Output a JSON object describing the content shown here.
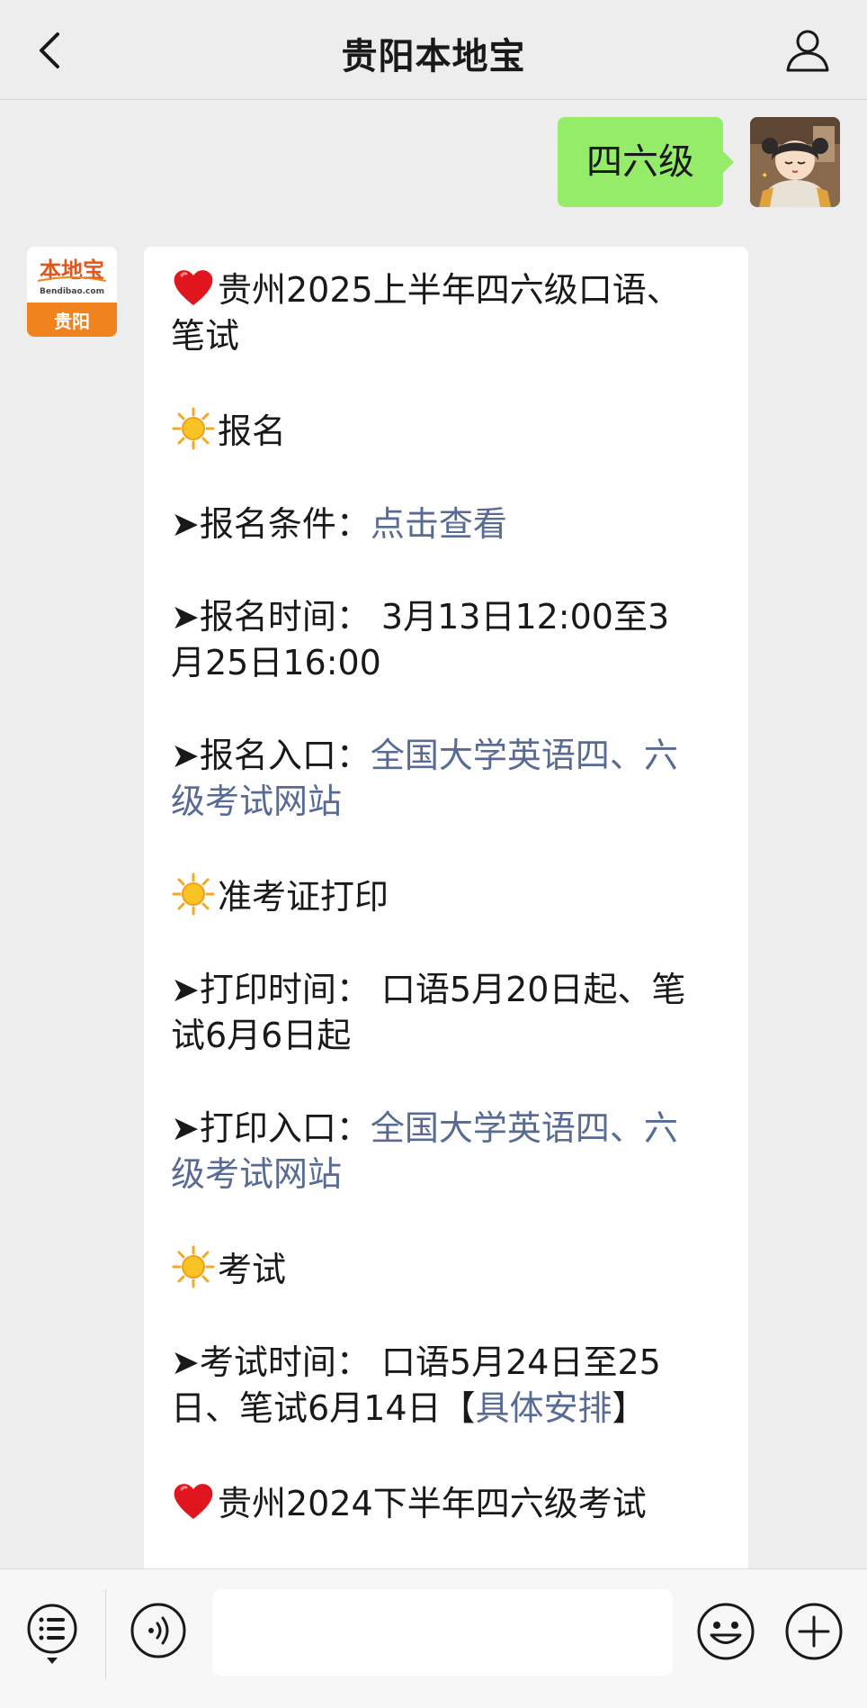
{
  "header": {
    "title": "贵阳本地宝",
    "back_icon": "chevron-left-icon",
    "profile_icon": "person-icon"
  },
  "outgoing": {
    "text": "四六级",
    "bubble_color": "#95ec69"
  },
  "bot_avatar": {
    "logo_text": "本地宝",
    "logo_domain": "Bendibao.com",
    "city": "贵阳",
    "brand_color": "#f0831e"
  },
  "message": {
    "link_color": "#576b95",
    "title1_a": "贵州2025上半年四六级口语、",
    "title1_b": "笔试",
    "sec_signup": "报名",
    "cond_label": "➤报名条件：",
    "cond_link": "点击查看",
    "time_a": "➤报名时间： 3月13日12:00至3",
    "time_b": "月25日16:00",
    "entry_label": "➤报名入口：",
    "entry_link_a": "全国大学英语四、六",
    "entry_link_b": "级考试网站",
    "sec_admit": "准考证打印",
    "print_time_a": "➤打印时间： 口语5月20日起、笔",
    "print_time_b": "试6月6日起",
    "print_entry_label": "➤打印入口：",
    "print_link_a": "全国大学英语四、六",
    "print_link_b": "级考试网站",
    "sec_exam": "考试",
    "exam_time_a": "➤考试时间： 口语5月24日至25",
    "exam_time_b_pre": "日、笔试6月14日【",
    "exam_link": "具体安排",
    "exam_time_b_post": "】",
    "title2": "贵州2024下半年四六级考试"
  },
  "input_bar": {
    "menu_icon": "list-menu-icon",
    "voice_icon": "voice-icon",
    "placeholder": "",
    "emoji_icon": "smiley-icon",
    "plus_icon": "plus-icon"
  }
}
